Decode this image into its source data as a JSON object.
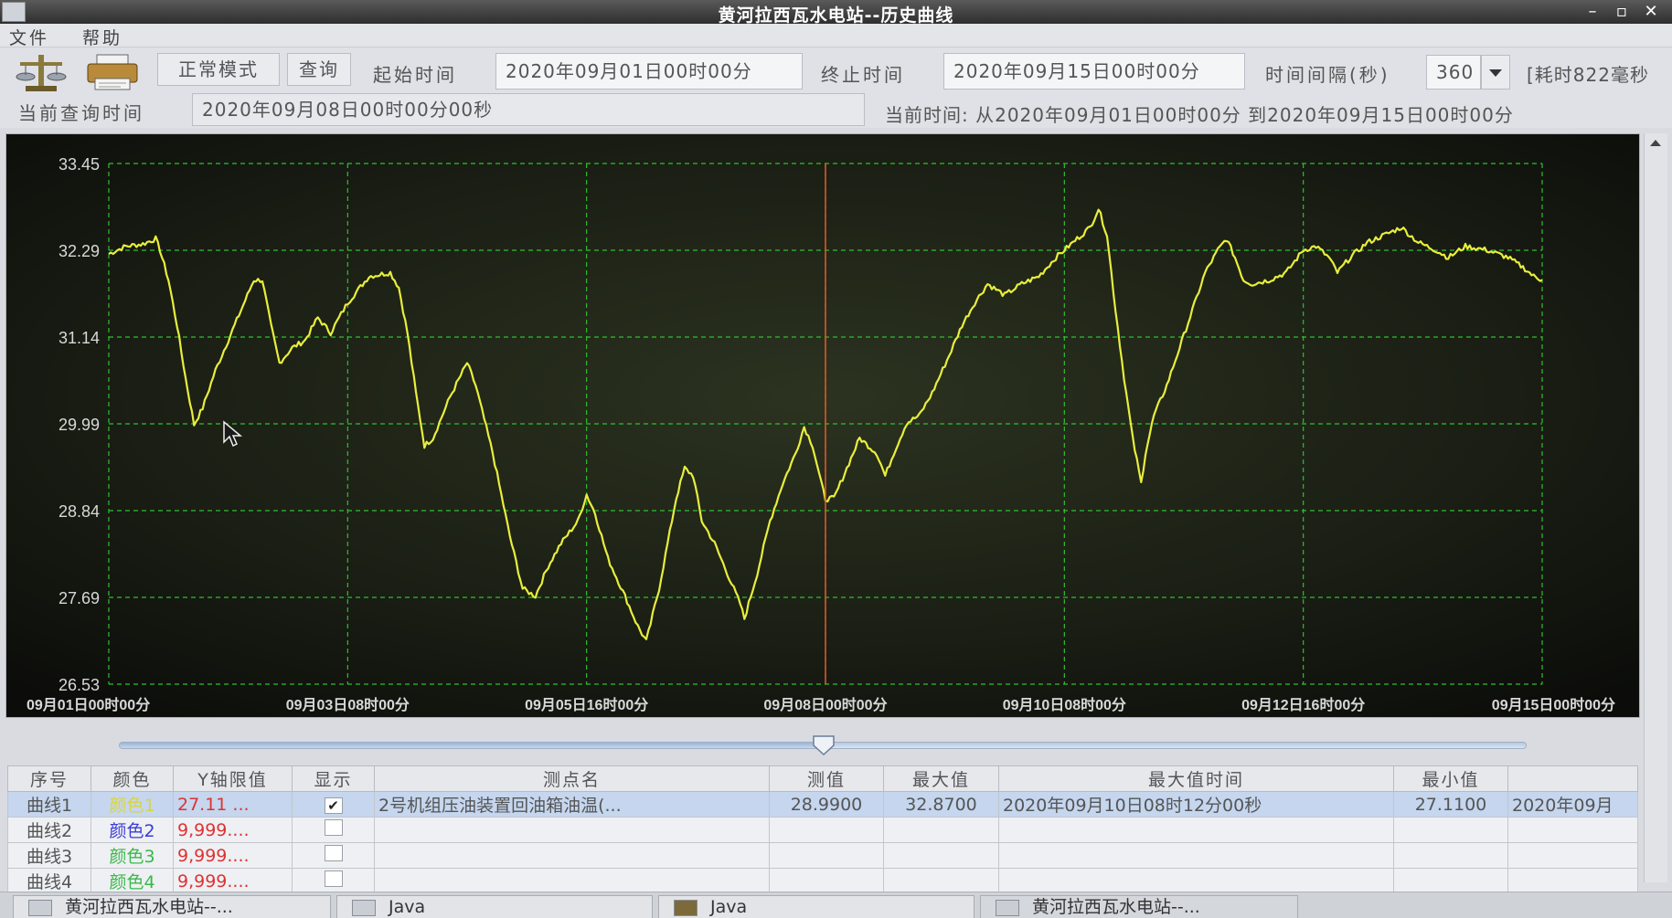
{
  "window": {
    "title": "黄河拉西瓦水电站--历史曲线"
  },
  "menu": {
    "items": [
      "文件",
      "帮助"
    ]
  },
  "toolbar": {
    "mode_button": "正常模式",
    "query_button": "查询",
    "start_label": "起始时间",
    "start_value": "2020年09月01日00时00分",
    "end_label": "终止时间",
    "end_value": "2020年09月15日00时00分",
    "interval_label": "时间间隔(秒)",
    "interval_value": "360",
    "elapsed": "[耗时822毫秒"
  },
  "info": {
    "query_time_label": "当前查询时间",
    "query_time_value": "2020年09月08日00时00分00秒",
    "current_range": "当前时间: 从2020年09月01日00时00分 到2020年09月15日00时00分"
  },
  "chart_data": {
    "type": "line",
    "title": "",
    "xlabel": "",
    "ylabel": "",
    "y_ticks": [
      "33.45",
      "32.29",
      "31.14",
      "29.99",
      "28.84",
      "27.69",
      "26.53"
    ],
    "ylim": [
      26.53,
      33.45
    ],
    "x_ticks": [
      "09月01日00时00分",
      "09月03日08时00分",
      "09月05日16时00分",
      "09月08日00时00分",
      "09月10日08时00分",
      "09月12日16时00分",
      "09月15日00时00分"
    ],
    "xlim_hours": [
      0,
      336
    ],
    "grid": true,
    "cursor_hour": 168,
    "series": [
      {
        "color": "#e8ee3c",
        "points": [
          [
            0,
            32.25
          ],
          [
            4,
            32.35
          ],
          [
            8,
            32.38
          ],
          [
            11,
            32.45
          ],
          [
            12,
            32.3
          ],
          [
            14,
            31.9
          ],
          [
            16,
            31.3
          ],
          [
            18,
            30.6
          ],
          [
            20,
            29.98
          ],
          [
            22,
            30.2
          ],
          [
            25,
            30.7
          ],
          [
            28,
            31.1
          ],
          [
            31,
            31.5
          ],
          [
            34,
            31.9
          ],
          [
            36,
            31.9
          ],
          [
            38,
            31.3
          ],
          [
            40,
            30.8
          ],
          [
            43,
            31.0
          ],
          [
            46,
            31.1
          ],
          [
            49,
            31.4
          ],
          [
            52,
            31.2
          ],
          [
            56,
            31.6
          ],
          [
            61,
            31.95
          ],
          [
            66,
            32.0
          ],
          [
            68,
            31.8
          ],
          [
            70,
            31.2
          ],
          [
            72,
            30.4
          ],
          [
            74,
            29.7
          ],
          [
            76,
            29.8
          ],
          [
            80,
            30.35
          ],
          [
            84,
            30.8
          ],
          [
            86,
            30.5
          ],
          [
            90,
            29.6
          ],
          [
            94,
            28.5
          ],
          [
            97,
            27.8
          ],
          [
            100,
            27.7
          ],
          [
            103,
            28.1
          ],
          [
            106,
            28.4
          ],
          [
            110,
            28.7
          ],
          [
            112,
            29.05
          ],
          [
            114,
            28.8
          ],
          [
            117,
            28.2
          ],
          [
            121,
            27.7
          ],
          [
            124,
            27.3
          ],
          [
            126,
            27.1
          ],
          [
            129,
            27.8
          ],
          [
            131,
            28.4
          ],
          [
            133,
            29.0
          ],
          [
            135,
            29.4
          ],
          [
            137,
            29.3
          ],
          [
            139,
            28.7
          ],
          [
            142,
            28.4
          ],
          [
            145,
            28.0
          ],
          [
            148,
            27.6
          ],
          [
            149,
            27.4
          ],
          [
            152,
            28.0
          ],
          [
            155,
            28.7
          ],
          [
            158,
            29.2
          ],
          [
            161,
            29.6
          ],
          [
            163,
            29.95
          ],
          [
            165,
            29.7
          ],
          [
            167,
            29.2
          ],
          [
            168,
            28.99
          ],
          [
            170,
            29.0
          ],
          [
            173,
            29.4
          ],
          [
            176,
            29.8
          ],
          [
            180,
            29.6
          ],
          [
            182,
            29.3
          ],
          [
            184,
            29.6
          ],
          [
            187,
            30.0
          ],
          [
            190,
            30.1
          ],
          [
            193,
            30.4
          ],
          [
            197,
            30.9
          ],
          [
            200,
            31.3
          ],
          [
            203,
            31.6
          ],
          [
            206,
            31.85
          ],
          [
            210,
            31.7
          ],
          [
            214,
            31.85
          ],
          [
            218,
            31.95
          ],
          [
            222,
            32.2
          ],
          [
            226,
            32.4
          ],
          [
            230,
            32.6
          ],
          [
            232,
            32.85
          ],
          [
            234,
            32.5
          ],
          [
            236,
            31.5
          ],
          [
            238,
            30.6
          ],
          [
            240,
            29.8
          ],
          [
            242,
            29.2
          ],
          [
            243,
            29.6
          ],
          [
            245,
            30.1
          ],
          [
            248,
            30.5
          ],
          [
            251,
            31.0
          ],
          [
            254,
            31.5
          ],
          [
            257,
            32.0
          ],
          [
            260,
            32.3
          ],
          [
            262,
            32.45
          ],
          [
            264,
            32.2
          ],
          [
            266,
            31.9
          ],
          [
            268,
            31.85
          ],
          [
            272,
            31.9
          ],
          [
            276,
            32.0
          ],
          [
            280,
            32.3
          ],
          [
            283,
            32.35
          ],
          [
            286,
            32.2
          ],
          [
            288,
            32.0
          ],
          [
            291,
            32.2
          ],
          [
            295,
            32.4
          ],
          [
            299,
            32.5
          ],
          [
            303,
            32.6
          ],
          [
            307,
            32.4
          ],
          [
            311,
            32.3
          ],
          [
            314,
            32.2
          ],
          [
            318,
            32.35
          ],
          [
            323,
            32.3
          ],
          [
            328,
            32.2
          ],
          [
            332,
            32.05
          ],
          [
            334,
            31.95
          ],
          [
            336,
            31.9
          ]
        ]
      }
    ]
  },
  "slider": {
    "position_fraction": 0.5
  },
  "table": {
    "headers": [
      "序号",
      "颜色",
      "Y轴限值",
      "显示",
      "测点名",
      "测值",
      "最大值",
      "最大值时间",
      "最小值",
      ""
    ],
    "rows": [
      {
        "name": "曲线1",
        "color_label": "颜色1",
        "color": "#d8d44a",
        "ylimit": "27.11 ...",
        "show": "✔",
        "point": "2号机组压油装置回油箱油温(...",
        "value": "28.9900",
        "max": "32.8700",
        "max_time": "2020年09月10日08时12分00秒",
        "min": "27.1100",
        "extra": "2020年09月"
      },
      {
        "name": "曲线2",
        "color_label": "颜色2",
        "color": "#3b3bd6",
        "ylimit": "9,999....",
        "show": "",
        "point": "",
        "value": "",
        "max": "",
        "max_time": "",
        "min": "",
        "extra": ""
      },
      {
        "name": "曲线3",
        "color_label": "颜色3",
        "color": "#3ab84a",
        "ylimit": "9,999....",
        "show": "",
        "point": "",
        "value": "",
        "max": "",
        "max_time": "",
        "min": "",
        "extra": ""
      },
      {
        "name": "曲线4",
        "color_label": "颜色4",
        "color": "#3ab84a",
        "ylimit": "9,999....",
        "show": "",
        "point": "",
        "value": "",
        "max": "",
        "max_time": "",
        "min": "",
        "extra": ""
      }
    ]
  },
  "taskbar": {
    "items": [
      "黄河拉西瓦水电站--...",
      "Java",
      "Java",
      "黄河拉西瓦水电站--..."
    ]
  },
  "colors": {
    "plot_bg": "#151810",
    "grid": "#2fbf2f",
    "line": "#e8ee3c",
    "cursor": "#e8552a",
    "tick_text": "#d8d8d8"
  }
}
